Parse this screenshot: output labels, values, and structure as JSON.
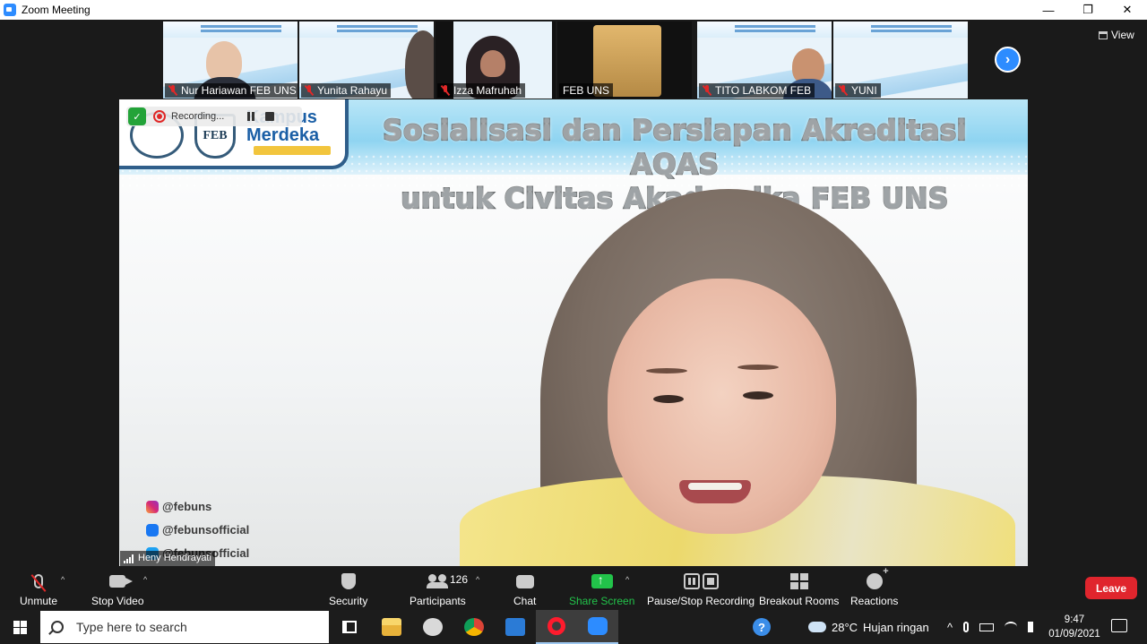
{
  "window": {
    "title": "Zoom Meeting",
    "minimize": "—",
    "restore": "❐",
    "close": "✕"
  },
  "gallery": {
    "thumbnails": [
      {
        "name": "Nur Hariawan FEB UNS",
        "muted": true
      },
      {
        "name": "Yunita Rahayu",
        "muted": true
      },
      {
        "name": "Izza Mafruhah",
        "muted": true
      },
      {
        "name": "FEB UNS",
        "muted": false
      },
      {
        "name": "TITO LABKOM FEB",
        "muted": true
      },
      {
        "name": "YUNI",
        "muted": true
      }
    ],
    "next_arrow": "›",
    "view_label": "View"
  },
  "recording": {
    "status": "Recording..."
  },
  "slide": {
    "title_line1": "Sosialisasi dan Persiapan Akreditasi AQAS",
    "title_line2": "untuk Civitas Akademika FEB UNS",
    "logo_feb": "FEB",
    "logo_kampus": "Kampus",
    "logo_merdeka": "Merdeka",
    "socials": [
      "@febuns",
      "@febunsofficial",
      "@febunsofficial"
    ]
  },
  "speaker": {
    "name": "Heny Hendrayati"
  },
  "toolbar": {
    "unmute": "Unmute",
    "stop_video": "Stop Video",
    "security": "Security",
    "participants": "Participants",
    "participants_count": "126",
    "chat": "Chat",
    "share_screen": "Share Screen",
    "pause_stop_recording": "Pause/Stop Recording",
    "breakout_rooms": "Breakout Rooms",
    "reactions": "Reactions",
    "leave": "Leave",
    "caret": "^"
  },
  "taskbar": {
    "search_placeholder": "Type here to search",
    "weather_temp": "28°C",
    "weather_desc": "Hujan ringan",
    "time": "9:47",
    "date": "01/09/2021",
    "help_icon": "?",
    "tray_caret": "^"
  },
  "colors": {
    "zoom_blue": "#2d8cff",
    "leave_red": "#e0252d",
    "share_green": "#22c34a",
    "muted_red": "#e02828"
  }
}
